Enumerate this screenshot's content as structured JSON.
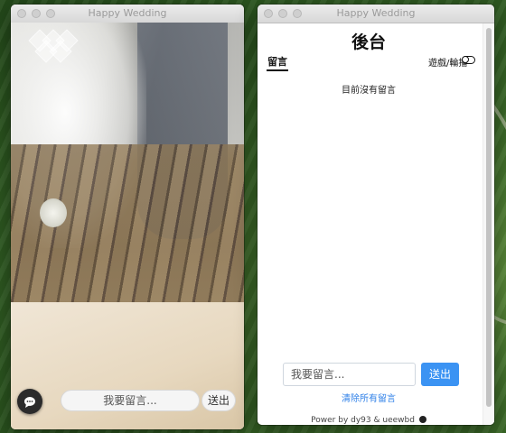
{
  "left_window": {
    "title": "Happy Wedding",
    "input_placeholder": "我要留言...",
    "send_label": "送出",
    "chat_icon": "chat-bubble-icon",
    "logo_icon": "diamond-logo-icon"
  },
  "right_window": {
    "title": "Happy Wedding",
    "page_title": "後台",
    "tab_label": "留言",
    "toggle_label": "遊戲/輪播",
    "empty_message": "目前沒有留言",
    "input_placeholder": "我要留言...",
    "send_label": "送出",
    "clear_label": "清除所有留言",
    "footer": "Power by dy93 & ueewbd",
    "footer_icon": "github-icon"
  },
  "colors": {
    "accent": "#3b93f3",
    "link": "#2f80e8"
  }
}
